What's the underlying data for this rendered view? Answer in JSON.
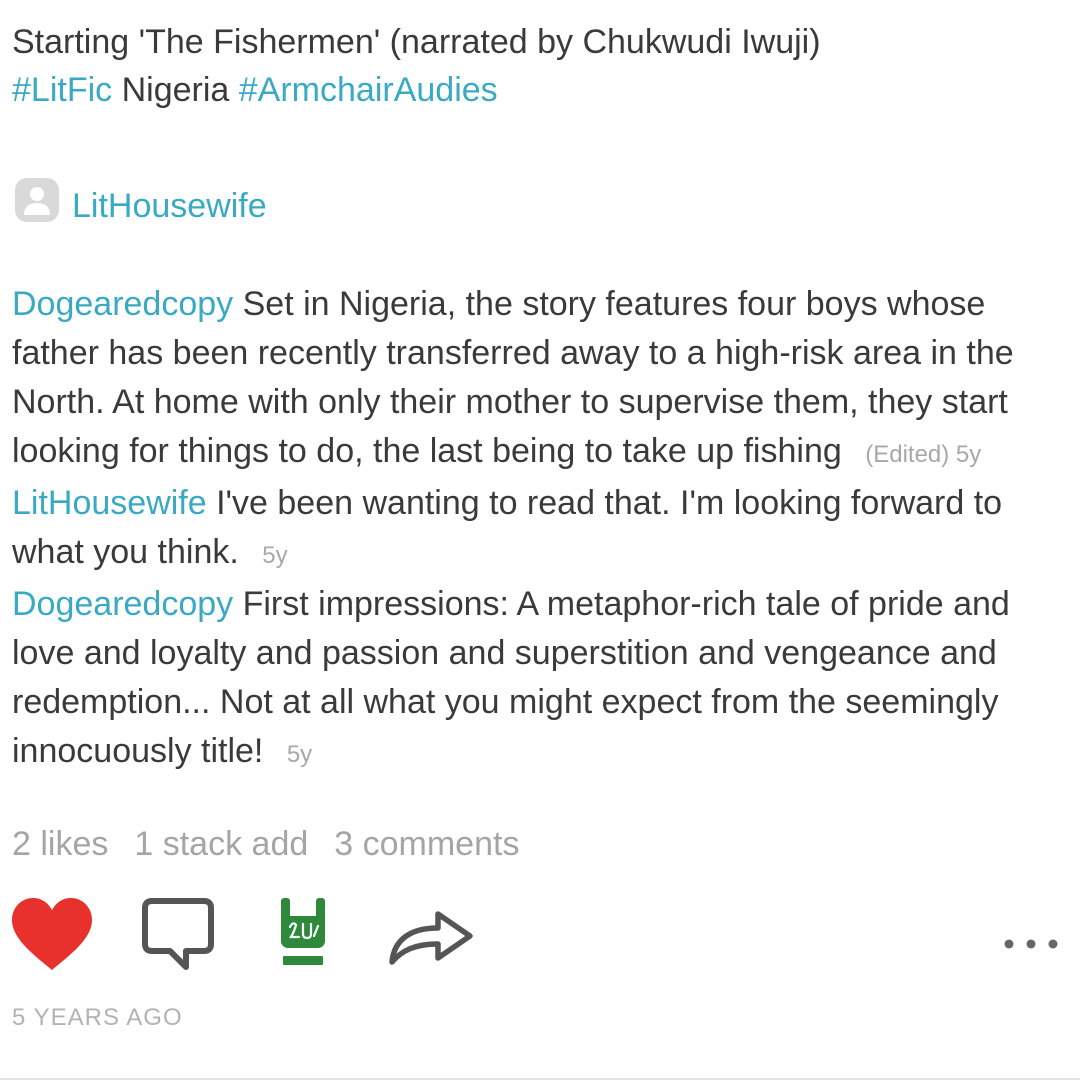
{
  "post": {
    "caption_text": "Starting 'The Fishermen' (narrated by Chukwudi Iwuji)",
    "tag_1": "#LitFic",
    "caption_mid": "Nigeria",
    "tag_2": "#ArmchairAudies",
    "author": "LitHousewife"
  },
  "comments": [
    {
      "user": "Dogearedcopy",
      "text": "Set in Nigeria, the story features four boys whose father has been recently transferred away to a high-risk area in the North. At home with only their mother to supervise them, they start looking for things to do, the last being to take up fishing",
      "meta": "(Edited) 5y"
    },
    {
      "user": "LitHousewife",
      "text": "I've been wanting to read that. I'm looking forward to what you think.",
      "meta": "5y"
    },
    {
      "user": "Dogearedcopy",
      "text": "First impressions: A metaphor-rich tale of pride and love and loyalty and passion and superstition and vengeance and redemption... Not at all what you might expect from the seemingly innocuously title!",
      "meta": "5y"
    }
  ],
  "stats": {
    "likes": "2 likes",
    "stack_adds": "1 stack add",
    "comments": "3 comments"
  },
  "actions": {
    "like_icon": "heart-icon",
    "comment_icon": "speech-bubble-icon",
    "stack_icon": "horns-hand-icon",
    "share_icon": "share-arrow-icon",
    "more_icon": "more-dots-icon",
    "like_color": "#e8302c",
    "stack_color": "#2e8a3a"
  },
  "timestamp": "5 YEARS AGO"
}
